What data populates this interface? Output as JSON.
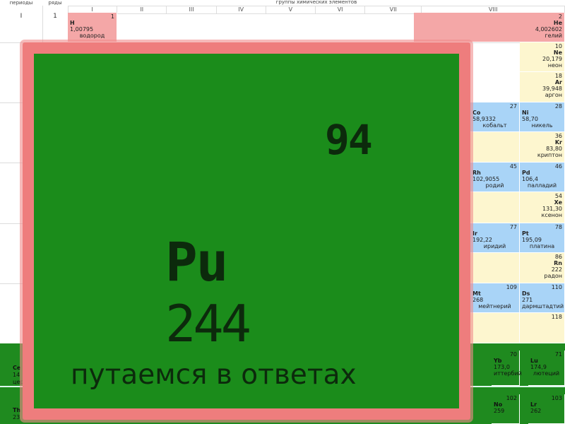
{
  "header": {
    "periods": "периоды",
    "rows": "ряды",
    "groups": "группы химических элементов",
    "roman": [
      "I",
      "II",
      "III",
      "IV",
      "V",
      "VI",
      "VII",
      "VIII"
    ]
  },
  "left": {
    "period_1": "I",
    "row_1": "1"
  },
  "elements": {
    "H": {
      "num": "1",
      "sym": "H",
      "mass": "1,00795",
      "name": "водород"
    },
    "He": {
      "num": "2",
      "sym": "He",
      "mass": "4,002602",
      "name": "гелий"
    },
    "Ne": {
      "num": "10",
      "sym": "Ne",
      "mass": "20,179",
      "name": "неон"
    },
    "Ar": {
      "num": "18",
      "sym": "Ar",
      "mass": "39,948",
      "name": "аргон"
    },
    "Co": {
      "num": "27",
      "sym": "Co",
      "mass": "58,9332",
      "name": "кобальт"
    },
    "Ni": {
      "num": "28",
      "sym": "Ni",
      "mass": "58,70",
      "name": "никель"
    },
    "Kr": {
      "num": "36",
      "sym": "Kr",
      "mass": "83,80",
      "name": "криптон"
    },
    "Rh": {
      "num": "45",
      "sym": "Rh",
      "mass": "102,9055",
      "name": "родий"
    },
    "Pd": {
      "num": "46",
      "sym": "Pd",
      "mass": "106,4",
      "name": "палладий"
    },
    "Xe": {
      "num": "54",
      "sym": "Xe",
      "mass": "131,30",
      "name": "ксенон"
    },
    "Ir": {
      "num": "77",
      "sym": "Ir",
      "mass": "192,22",
      "name": "иридий"
    },
    "Pt": {
      "num": "78",
      "sym": "Pt",
      "mass": "195,09",
      "name": "платина"
    },
    "Rn": {
      "num": "86",
      "sym": "Rn",
      "mass": "222",
      "name": "радон"
    },
    "Mt": {
      "num": "109",
      "sym": "Mt",
      "mass": "268",
      "name": "мейтнерий"
    },
    "Ds": {
      "num": "110",
      "sym": "Ds",
      "mass": "271",
      "name": "дармштадтий"
    },
    "Og": {
      "num": "118"
    },
    "Yb": {
      "num": "70",
      "sym": "Yb",
      "mass": "173,0",
      "name": "иттербий"
    },
    "Lu": {
      "num": "71",
      "sym": "Lu",
      "mass": "174,9",
      "name": "лютеций"
    },
    "No": {
      "num": "102",
      "sym": "No",
      "mass": "259",
      "name": "нобелий"
    },
    "Lr": {
      "num": "103",
      "sym": "Lr",
      "mass": "262",
      "name": "лоуренсий"
    }
  },
  "strip_partial": {
    "ce_sym": "Ce",
    "ce_mass": "14",
    "ce_name": "цер",
    "th_sym": "Th",
    "th_mass": "23"
  },
  "overlay": {
    "number": "94",
    "symbol": "Pu",
    "mass": "244",
    "caption": "путаемся в ответах"
  },
  "colors": {
    "s_block": "#f4a7a7",
    "noble": "#fdf6cf",
    "d_block": "#a9d4f7",
    "f_block": "#1f8a1f",
    "overlay_border": "#ee7d7d",
    "overlay_bg": "#1b8c1b"
  }
}
